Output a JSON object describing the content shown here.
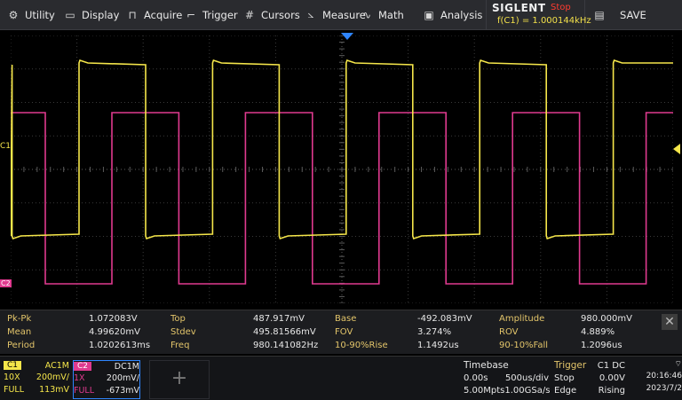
{
  "menu": {
    "items": [
      {
        "label": "Utility",
        "icon": "gear-icon"
      },
      {
        "label": "Display",
        "icon": "monitor-icon"
      },
      {
        "label": "Acquire",
        "icon": "acquire-icon"
      },
      {
        "label": "Trigger",
        "icon": "trigger-icon"
      },
      {
        "label": "Cursors",
        "icon": "cursors-icon"
      },
      {
        "label": "Measure",
        "icon": "measure-icon"
      },
      {
        "label": "Math",
        "icon": "math-icon"
      },
      {
        "label": "Analysis",
        "icon": "analysis-icon"
      }
    ],
    "brand": "SIGLENT",
    "run_state": "Stop",
    "freq_readout": "f(C1) = 1.000144kHz",
    "save_label": "SAVE"
  },
  "screen": {
    "c1_marker": "C1",
    "c2_marker": "C2",
    "colors": {
      "ch1": "#f5e64a",
      "ch2": "#e03a8f",
      "grid": "#3a3a3a",
      "trigger": "#2f86ff"
    }
  },
  "measurements": [
    {
      "name": "Pk-Pk",
      "value": "1.072083V"
    },
    {
      "name": "Top",
      "value": "487.917mV"
    },
    {
      "name": "Base",
      "value": "-492.083mV"
    },
    {
      "name": "Amplitude",
      "value": "980.000mV"
    },
    {
      "name": "Mean",
      "value": "4.99620mV"
    },
    {
      "name": "Stdev",
      "value": "495.81566mV"
    },
    {
      "name": "FOV",
      "value": "3.274%"
    },
    {
      "name": "ROV",
      "value": "4.889%"
    },
    {
      "name": "Period",
      "value": "1.0202613ms"
    },
    {
      "name": "Freq",
      "value": "980.141082Hz"
    },
    {
      "name": "10-90%Rise",
      "value": "1.1492us"
    },
    {
      "name": "90-10%Fall",
      "value": "1.2096us"
    }
  ],
  "ch1": {
    "tag": "C1",
    "coupling": "AC1M",
    "probe": "10X",
    "scale": "200mV/",
    "bw": "FULL",
    "offset": "113mV"
  },
  "ch2": {
    "tag": "C2",
    "coupling": "DC1M",
    "probe": "1X",
    "scale": "200mV/",
    "bw": "FULL",
    "offset": "-673mV"
  },
  "timebase": {
    "title": "Timebase",
    "delay": "0.00s",
    "scale": "500us/div",
    "memory": "5.00Mpts",
    "rate": "1.00GSa/s"
  },
  "trigger": {
    "title": "Trigger",
    "source": "C1 DC",
    "mode": "Stop",
    "level": "0.00V",
    "type": "Edge",
    "slope": "Rising"
  },
  "clock": {
    "time": "20:16:46",
    "date": "2023/7/2"
  }
}
